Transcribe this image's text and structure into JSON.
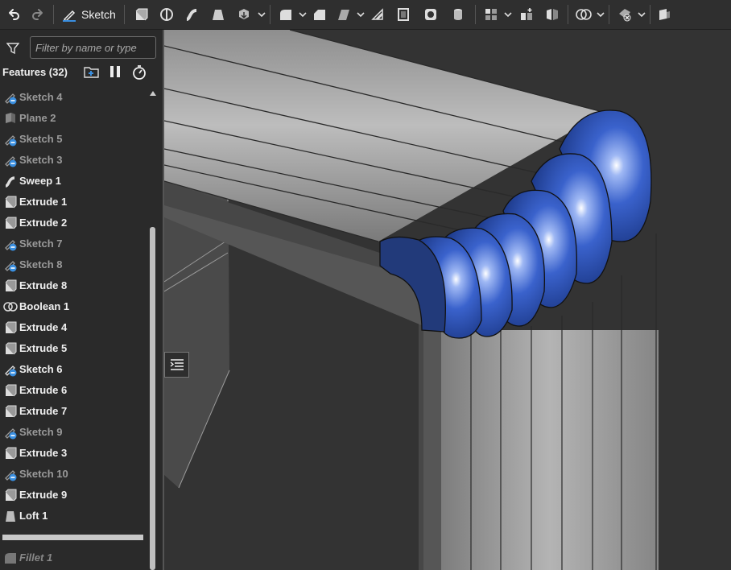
{
  "toolbar": {
    "sketch_label": "Sketch",
    "icons": [
      "undo-icon",
      "redo-icon",
      "sketch-icon",
      "extrude-icon",
      "revolve-icon",
      "sweep-icon",
      "loft-icon",
      "thicken-icon",
      "fillet-icon",
      "chamfer-icon",
      "draft-icon",
      "rib-icon",
      "shell-icon",
      "hole-icon",
      "cylinder-icon",
      "pattern-icon",
      "derive-icon",
      "mirror-icon",
      "boolean-icon",
      "split-icon",
      "transform-icon"
    ]
  },
  "panel": {
    "filter_placeholder": "Filter by name or type",
    "features_title": "Features (32)",
    "header_icons": [
      "add-folder-icon",
      "pause-icon",
      "stopwatch-icon"
    ],
    "items": [
      {
        "label": "Sketch 4",
        "icon": "sketch-hidden-icon",
        "state": "off"
      },
      {
        "label": "Plane 2",
        "icon": "plane-icon",
        "state": "off"
      },
      {
        "label": "Sketch 5",
        "icon": "sketch-hidden-icon",
        "state": "off"
      },
      {
        "label": "Sketch 3",
        "icon": "sketch-hidden-icon",
        "state": "off"
      },
      {
        "label": "Sweep 1",
        "icon": "sweep-icon",
        "state": "on"
      },
      {
        "label": "Extrude 1",
        "icon": "extrude-icon",
        "state": "on"
      },
      {
        "label": "Extrude 2",
        "icon": "extrude-icon",
        "state": "on"
      },
      {
        "label": "Sketch 7",
        "icon": "sketch-hidden-icon",
        "state": "off"
      },
      {
        "label": "Sketch 8",
        "icon": "sketch-hidden-icon",
        "state": "off"
      },
      {
        "label": "Extrude 8",
        "icon": "extrude-icon",
        "state": "on"
      },
      {
        "label": "Boolean 1",
        "icon": "boolean-icon",
        "state": "on"
      },
      {
        "label": "Extrude 4",
        "icon": "extrude-icon",
        "state": "on"
      },
      {
        "label": "Extrude 5",
        "icon": "extrude-icon",
        "state": "on"
      },
      {
        "label": "Sketch 6",
        "icon": "sketch-visible-icon",
        "state": "on"
      },
      {
        "label": "Extrude 6",
        "icon": "extrude-icon",
        "state": "on"
      },
      {
        "label": "Extrude 7",
        "icon": "extrude-icon",
        "state": "on"
      },
      {
        "label": "Sketch 9",
        "icon": "sketch-hidden-icon",
        "state": "off"
      },
      {
        "label": "Extrude 3",
        "icon": "extrude-icon",
        "state": "on"
      },
      {
        "label": "Sketch 10",
        "icon": "sketch-hidden-icon",
        "state": "off"
      },
      {
        "label": "Extrude 9",
        "icon": "extrude-icon",
        "state": "on"
      },
      {
        "label": "Loft 1",
        "icon": "loft-icon",
        "state": "on"
      }
    ],
    "rolled_back_item": {
      "label": "Fillet 1",
      "icon": "fillet-icon"
    }
  },
  "colors": {
    "accent_blue": "#2f55b8",
    "sketch_badge": "#3a8fe0",
    "pipe_gray": "#9a9a9a",
    "viewport_bg": "#333333"
  }
}
